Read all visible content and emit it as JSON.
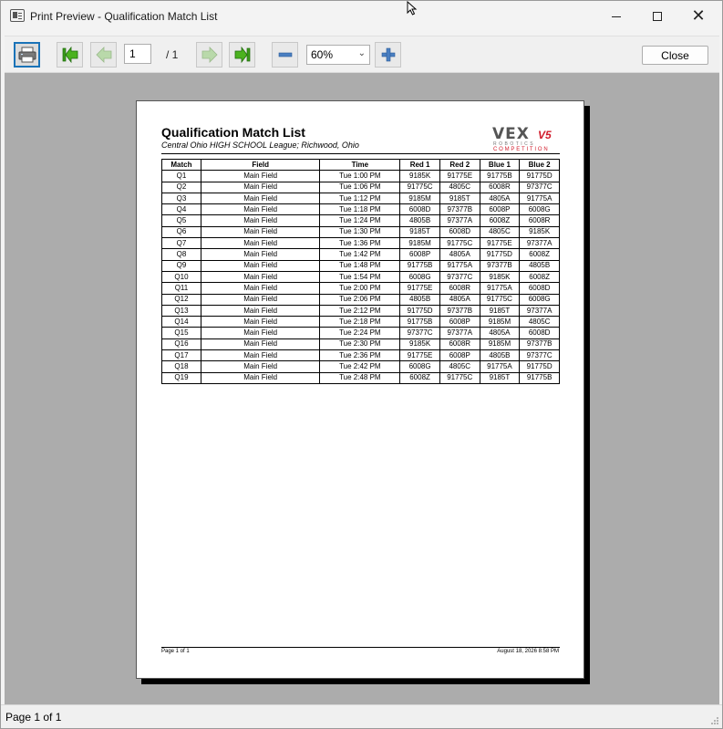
{
  "window": {
    "title": "Print Preview - Qualification Match List"
  },
  "toolbar": {
    "page_current": "1",
    "page_total": "/ 1",
    "zoom": "60%",
    "close_label": "Close"
  },
  "report": {
    "title": "Qualification Match List",
    "subtitle": "Central Ohio HIGH SCHOOL League; Richwood, Ohio",
    "logo": {
      "vex": "VEX",
      "v5": "V5",
      "robotics": "ROBOTICS",
      "competition": "COMPETITION"
    },
    "columns": [
      "Match",
      "Field",
      "Time",
      "Red 1",
      "Red 2",
      "Blue 1",
      "Blue 2"
    ],
    "rows": [
      [
        "Q1",
        "Main Field",
        "Tue 1:00 PM",
        "9185K",
        "91775E",
        "91775B",
        "91775D"
      ],
      [
        "Q2",
        "Main Field",
        "Tue 1:06 PM",
        "91775C",
        "4805C",
        "6008R",
        "97377C"
      ],
      [
        "Q3",
        "Main Field",
        "Tue 1:12 PM",
        "9185M",
        "9185T",
        "4805A",
        "91775A"
      ],
      [
        "Q4",
        "Main Field",
        "Tue 1:18 PM",
        "6008D",
        "97377B",
        "6008P",
        "6008G"
      ],
      [
        "Q5",
        "Main Field",
        "Tue 1:24 PM",
        "4805B",
        "97377A",
        "6008Z",
        "6008R"
      ],
      [
        "Q6",
        "Main Field",
        "Tue 1:30 PM",
        "9185T",
        "6008D",
        "4805C",
        "9185K"
      ],
      [
        "Q7",
        "Main Field",
        "Tue 1:36 PM",
        "9185M",
        "91775C",
        "91775E",
        "97377A"
      ],
      [
        "Q8",
        "Main Field",
        "Tue 1:42 PM",
        "6008P",
        "4805A",
        "91775D",
        "6008Z"
      ],
      [
        "Q9",
        "Main Field",
        "Tue 1:48 PM",
        "91775B",
        "91775A",
        "97377B",
        "4805B"
      ],
      [
        "Q10",
        "Main Field",
        "Tue 1:54 PM",
        "6008G",
        "97377C",
        "9185K",
        "6008Z"
      ],
      [
        "Q11",
        "Main Field",
        "Tue 2:00 PM",
        "91775E",
        "6008R",
        "91775A",
        "6008D"
      ],
      [
        "Q12",
        "Main Field",
        "Tue 2:06 PM",
        "4805B",
        "4805A",
        "91775C",
        "6008G"
      ],
      [
        "Q13",
        "Main Field",
        "Tue 2:12 PM",
        "91775D",
        "97377B",
        "9185T",
        "97377A"
      ],
      [
        "Q14",
        "Main Field",
        "Tue 2:18 PM",
        "91775B",
        "6008P",
        "9185M",
        "4805C"
      ],
      [
        "Q15",
        "Main Field",
        "Tue 2:24 PM",
        "97377C",
        "97377A",
        "4805A",
        "6008D"
      ],
      [
        "Q16",
        "Main Field",
        "Tue 2:30 PM",
        "9185K",
        "6008R",
        "9185M",
        "97377B"
      ],
      [
        "Q17",
        "Main Field",
        "Tue 2:36 PM",
        "91775E",
        "6008P",
        "4805B",
        "97377C"
      ],
      [
        "Q18",
        "Main Field",
        "Tue 2:42 PM",
        "6008G",
        "4805C",
        "91775A",
        "91775D"
      ],
      [
        "Q19",
        "Main Field",
        "Tue 2:48 PM",
        "6008Z",
        "91775C",
        "9185T",
        "91775B"
      ]
    ],
    "footer_left": "Page 1 of 1",
    "footer_right": "August 18, 2026 8:58 PM"
  },
  "status": {
    "text": "Page 1 of 1"
  },
  "colors": {
    "accent": "#1a73b8",
    "nav_green": "#3a9a1a",
    "logo_red": "#d11a2a",
    "preview_bg": "#acacac"
  },
  "icons": [
    "app-icon",
    "printer-icon",
    "first-page-icon",
    "prev-page-icon",
    "next-page-icon",
    "last-page-icon",
    "zoom-out-icon",
    "zoom-in-icon",
    "chevron-down-icon",
    "resize-grip-icon",
    "mouse-cursor-icon"
  ]
}
